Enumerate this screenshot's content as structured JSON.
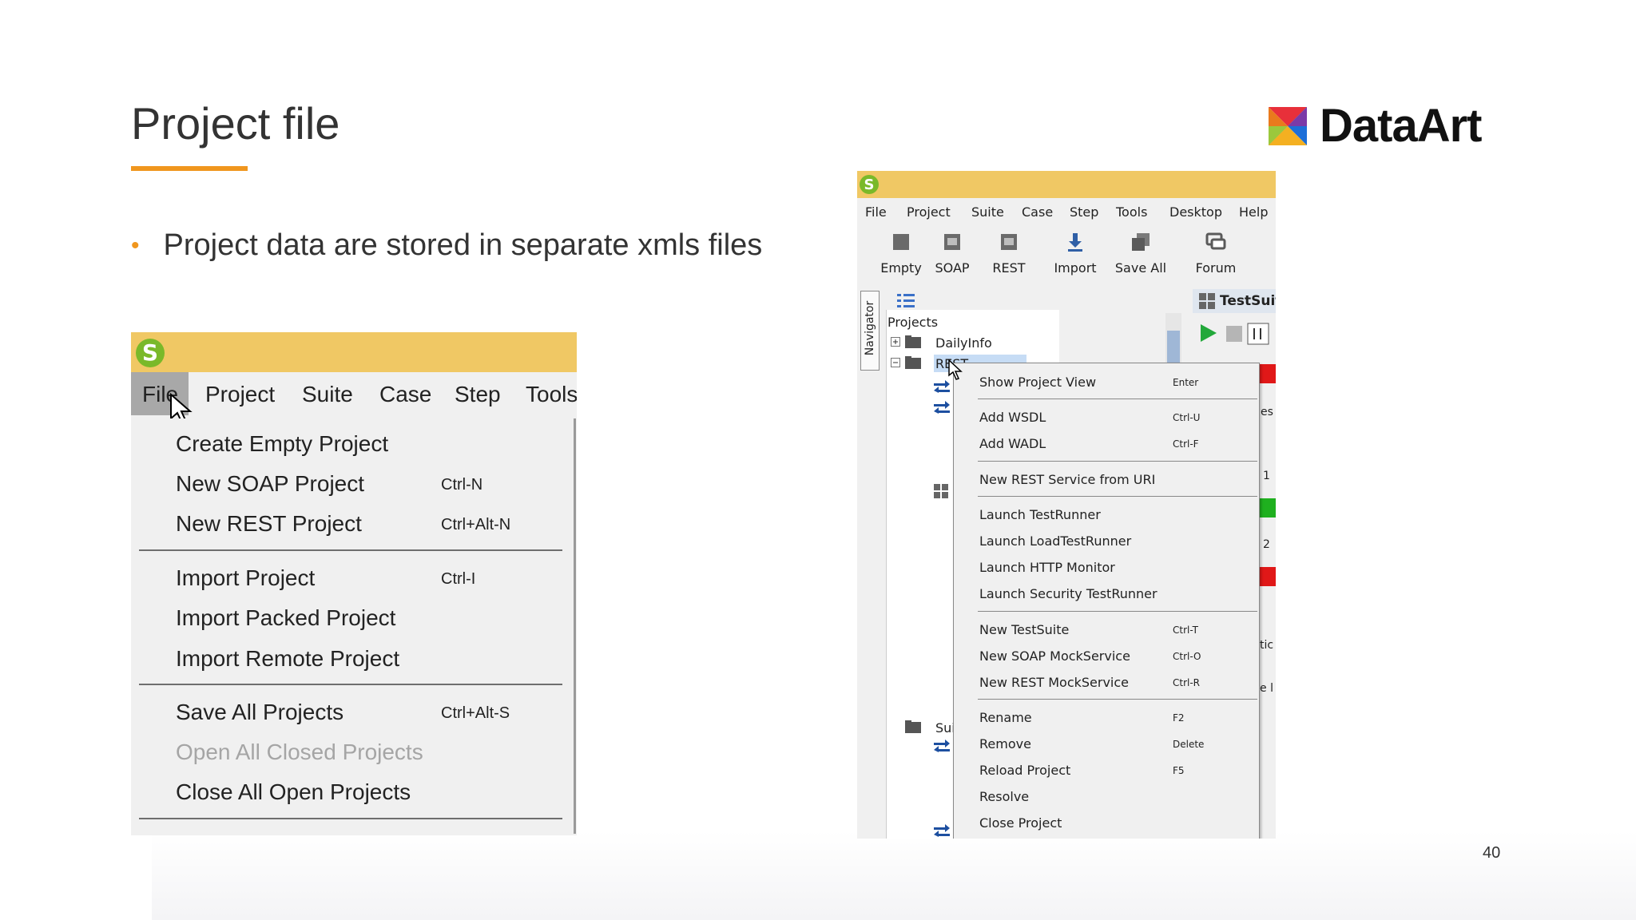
{
  "slide": {
    "title": "Project file",
    "bullet": "Project data are stored in separate xmls files",
    "logo_text": "DataArt",
    "page_number": "40",
    "accent_color": "#f0961e"
  },
  "left_screenshot": {
    "app_icon": "soapui-logo-icon",
    "menu": [
      "File",
      "Project",
      "Suite",
      "Case",
      "Step",
      "Tools"
    ],
    "dropdown": [
      {
        "label": "Create Empty Project",
        "shortcut": ""
      },
      {
        "label": "New SOAP Project",
        "shortcut": "Ctrl-N"
      },
      {
        "label": "New REST Project",
        "shortcut": "Ctrl+Alt-N"
      },
      {
        "label": "Import Project",
        "shortcut": "Ctrl-I"
      },
      {
        "label": "Import Packed Project",
        "shortcut": ""
      },
      {
        "label": "Import Remote Project",
        "shortcut": ""
      },
      {
        "label": "Save All Projects",
        "shortcut": "Ctrl+Alt-S"
      },
      {
        "label": "Open All Closed Projects",
        "shortcut": "",
        "disabled": true
      },
      {
        "label": "Close All Open Projects",
        "shortcut": ""
      }
    ]
  },
  "right_screenshot": {
    "menu": [
      "File",
      "Project",
      "Suite",
      "Case",
      "Step",
      "Tools",
      "Desktop",
      "Help"
    ],
    "toolbar": [
      "Empty",
      "SOAP",
      "REST",
      "Import",
      "Save All",
      "Forum"
    ],
    "navigator_label": "Navigator",
    "tree": {
      "root": "Projects",
      "items": [
        "DailyInfo",
        "REST",
        "Sui"
      ]
    },
    "panel_title": "TestSuit",
    "edge_fragments": [
      "es",
      "1",
      "2",
      "tic",
      "e l"
    ],
    "context_menu": [
      {
        "label": "Show Project View",
        "shortcut": "Enter"
      },
      {
        "label": "Add WSDL",
        "shortcut": "Ctrl-U"
      },
      {
        "label": "Add WADL",
        "shortcut": "Ctrl-F"
      },
      {
        "label": "New REST Service from URI",
        "shortcut": ""
      },
      {
        "label": "Launch TestRunner",
        "shortcut": ""
      },
      {
        "label": "Launch LoadTestRunner",
        "shortcut": ""
      },
      {
        "label": "Launch HTTP Monitor",
        "shortcut": ""
      },
      {
        "label": "Launch Security TestRunner",
        "shortcut": ""
      },
      {
        "label": "New TestSuite",
        "shortcut": "Ctrl-T"
      },
      {
        "label": "New SOAP MockService",
        "shortcut": "Ctrl-O"
      },
      {
        "label": "New REST MockService",
        "shortcut": "Ctrl-R"
      },
      {
        "label": "Rename",
        "shortcut": "F2"
      },
      {
        "label": "Remove",
        "shortcut": "Delete"
      },
      {
        "label": "Reload Project",
        "shortcut": "F5"
      },
      {
        "label": "Resolve",
        "shortcut": ""
      },
      {
        "label": "Close Project",
        "shortcut": ""
      }
    ]
  }
}
